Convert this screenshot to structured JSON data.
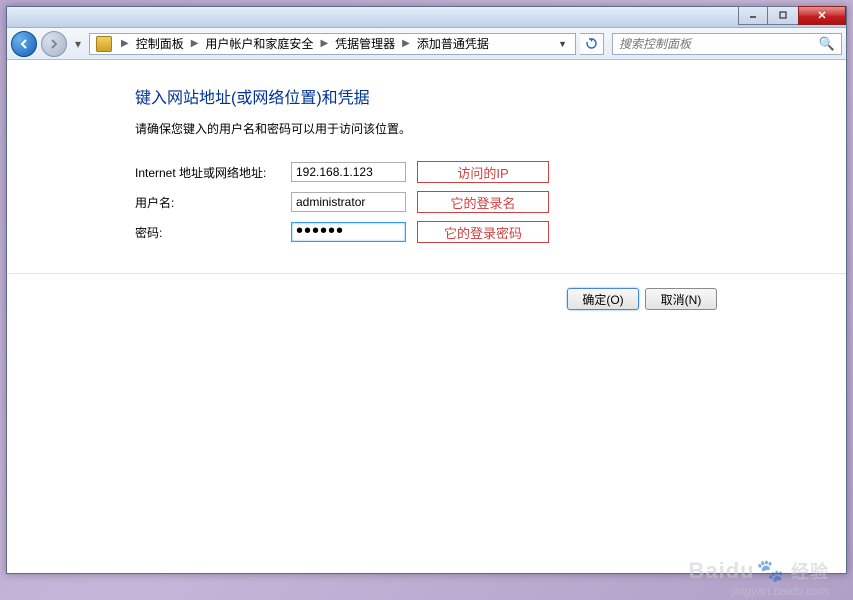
{
  "breadcrumb": {
    "items": [
      "控制面板",
      "用户帐户和家庭安全",
      "凭据管理器",
      "添加普通凭据"
    ]
  },
  "search": {
    "placeholder": "搜索控制面板"
  },
  "page": {
    "heading": "键入网站地址(或网络位置)和凭据",
    "subtext": "请确保您键入的用户名和密码可以用于访问该位置。"
  },
  "form": {
    "addressLabel": "Internet 地址或网络地址:",
    "addressValue": "192.168.1.123",
    "addressHint": "访问的IP",
    "userLabel": "用户名:",
    "userValue": "administrator",
    "userHint": "它的登录名",
    "passLabel": "密码:",
    "passValue": "••••••",
    "passHint": "它的登录密码"
  },
  "buttons": {
    "ok": "确定(O)",
    "cancel": "取消(N)"
  },
  "watermark": {
    "brand": "Baidu",
    "brandCn": "经验",
    "url": "jingyan.baidu.com"
  }
}
